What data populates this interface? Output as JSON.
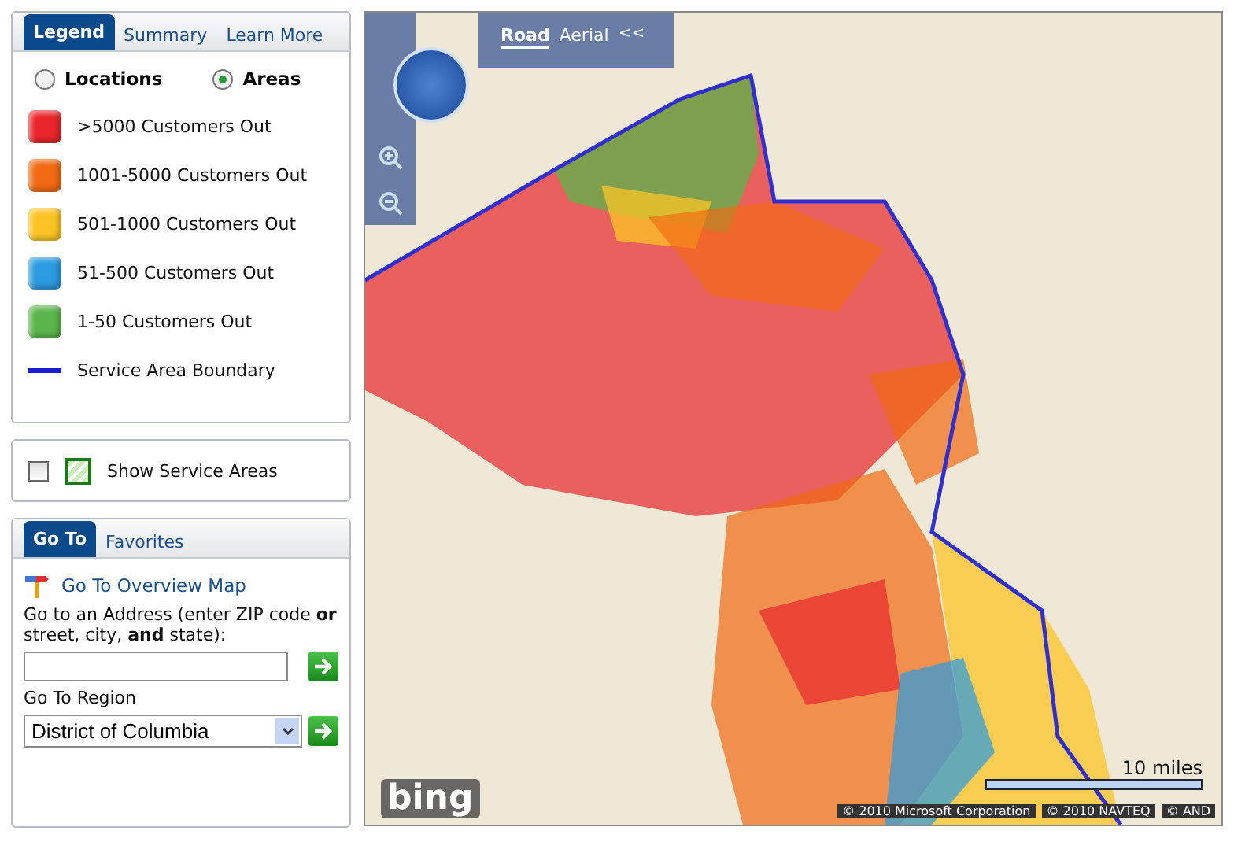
{
  "legend_panel": {
    "tabs": [
      {
        "label": "Legend",
        "selected": true
      },
      {
        "label": "Summary",
        "selected": false
      },
      {
        "label": "Learn More",
        "selected": false
      }
    ],
    "view_options": [
      {
        "label": "Locations",
        "selected": false
      },
      {
        "label": "Areas",
        "selected": true
      }
    ],
    "items": [
      {
        "kind": "swatch",
        "color": "#e8262b",
        "label": ">5000 Customers Out"
      },
      {
        "kind": "swatch",
        "color": "#f26a13",
        "label": "1001-5000 Customers Out"
      },
      {
        "kind": "swatch",
        "color": "#fbc425",
        "label": "501-1000 Customers Out"
      },
      {
        "kind": "swatch",
        "color": "#2a9be0",
        "label": "51-500 Customers Out"
      },
      {
        "kind": "swatch",
        "color": "#5ab54a",
        "label": "1-50 Customers Out"
      },
      {
        "kind": "line",
        "color": "#1b1fd0",
        "label": "Service Area Boundary"
      }
    ]
  },
  "service_areas": {
    "checked": false,
    "label": "Show Service Areas"
  },
  "goto_panel": {
    "tabs": [
      {
        "label": "Go To",
        "selected": true
      },
      {
        "label": "Favorites",
        "selected": false
      }
    ],
    "overview_link": "Go To Overview Map",
    "address_label": "Go to an Address (enter ZIP code **or** street, city, **and** state):",
    "region_label": "Go To Region",
    "region_value": "District of Columbia"
  },
  "map": {
    "view_tabs": [
      {
        "label": "Road",
        "selected": true
      },
      {
        "label": "Aerial",
        "selected": false
      }
    ],
    "collapse": "<<",
    "scale": "10 miles",
    "logo": "bing",
    "copyrights": [
      "© 2010 Microsoft Corporation",
      "© 2010 NAVTEQ",
      "© AND"
    ]
  }
}
